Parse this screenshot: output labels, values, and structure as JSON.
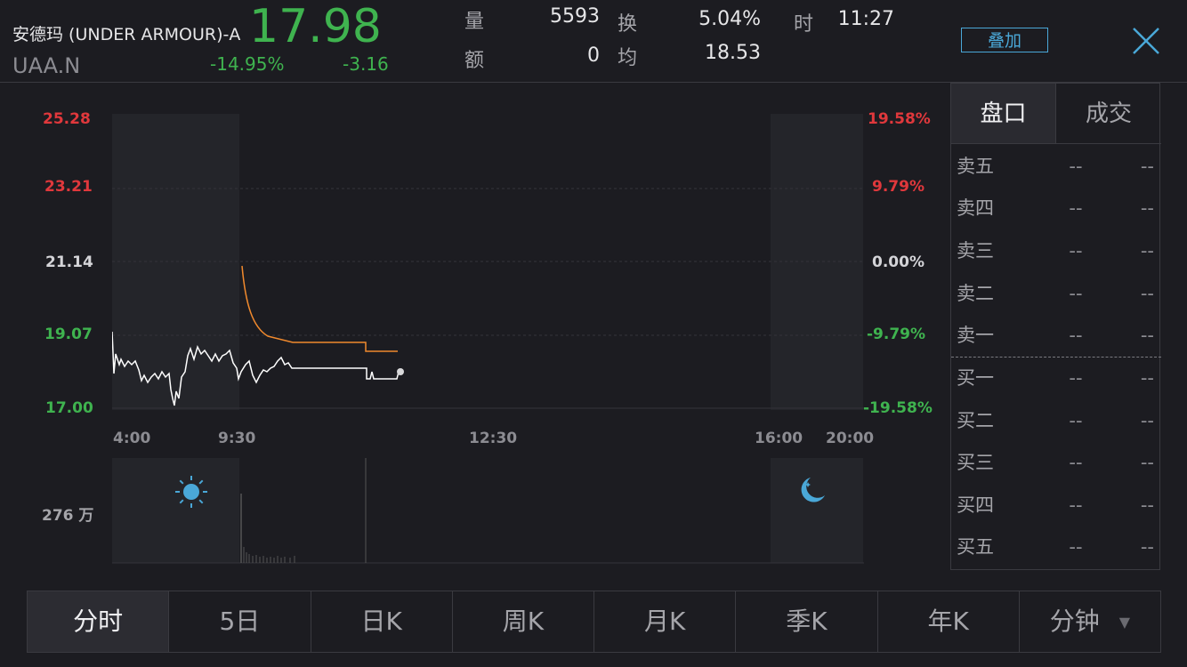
{
  "header": {
    "stock_name": "安德玛 (UNDER ARMOUR)-A",
    "stock_code": "UAA.N",
    "price": "17.98",
    "change_pct": "-14.95%",
    "change_abs": "-3.16",
    "volume_label": "量",
    "volume_value": "5593",
    "amount_label": "额",
    "amount_value": "0",
    "turnover_label": "换",
    "turnover_value": "5.04%",
    "avg_label": "均",
    "avg_value": "18.53",
    "time_label": "时",
    "time_value": "11:27",
    "overlay_label": "叠加",
    "close_icon": "close-icon"
  },
  "chart": {
    "y_left": [
      "25.28",
      "23.21",
      "21.14",
      "19.07",
      "17.00"
    ],
    "y_right": [
      "19.58%",
      "9.79%",
      "0.00%",
      "-9.79%",
      "-19.58%"
    ],
    "x_labels": [
      "4:00",
      "9:30",
      "12:30",
      "16:00",
      "20:00"
    ],
    "volume_label": "276 万",
    "pre_market_icon": "sun-icon",
    "after_hours_icon": "moon-icon",
    "colors": {
      "price_line": "#ffffff",
      "avg_line": "#f0892d",
      "up": "#e0383c",
      "down": "#3fb34f"
    }
  },
  "chart_data": {
    "type": "line",
    "ylim": [
      17.0,
      25.28
    ],
    "series": [
      {
        "name": "",
        "x": [
          "4:00",
          "5:00",
          "6:00",
          "7:00",
          "8:00",
          "9:00",
          "9:30",
          "10:00",
          "10:30",
          "11:00",
          "11:27"
        ],
        "values": [
          18.9,
          18.1,
          17.2,
          18.5,
          18.2,
          18.0,
          17.95,
          18.3,
          18.05,
          18.05,
          17.98
        ]
      },
      {
        "name": "",
        "x": [
          "9:30",
          "9:45",
          "10:00",
          "10:15",
          "10:30",
          "11:00",
          "11:27"
        ],
        "values": [
          20.95,
          19.4,
          18.85,
          18.8,
          18.8,
          18.55,
          18.55
        ]
      }
    ]
  },
  "orderbook": {
    "tab_active": "盘口",
    "tab_inactive": "成交",
    "rows": [
      {
        "name": "卖五",
        "price": "--",
        "qty": "--"
      },
      {
        "name": "卖四",
        "price": "--",
        "qty": "--"
      },
      {
        "name": "卖三",
        "price": "--",
        "qty": "--"
      },
      {
        "name": "卖二",
        "price": "--",
        "qty": "--"
      },
      {
        "name": "卖一",
        "price": "--",
        "qty": "--"
      },
      {
        "name": "买一",
        "price": "--",
        "qty": "--"
      },
      {
        "name": "买二",
        "price": "--",
        "qty": "--"
      },
      {
        "name": "买三",
        "price": "--",
        "qty": "--"
      },
      {
        "name": "买四",
        "price": "--",
        "qty": "--"
      },
      {
        "name": "买五",
        "price": "--",
        "qty": "--"
      }
    ]
  },
  "periods": [
    "分时",
    "5日",
    "日K",
    "周K",
    "月K",
    "季K",
    "年K",
    "分钟"
  ]
}
